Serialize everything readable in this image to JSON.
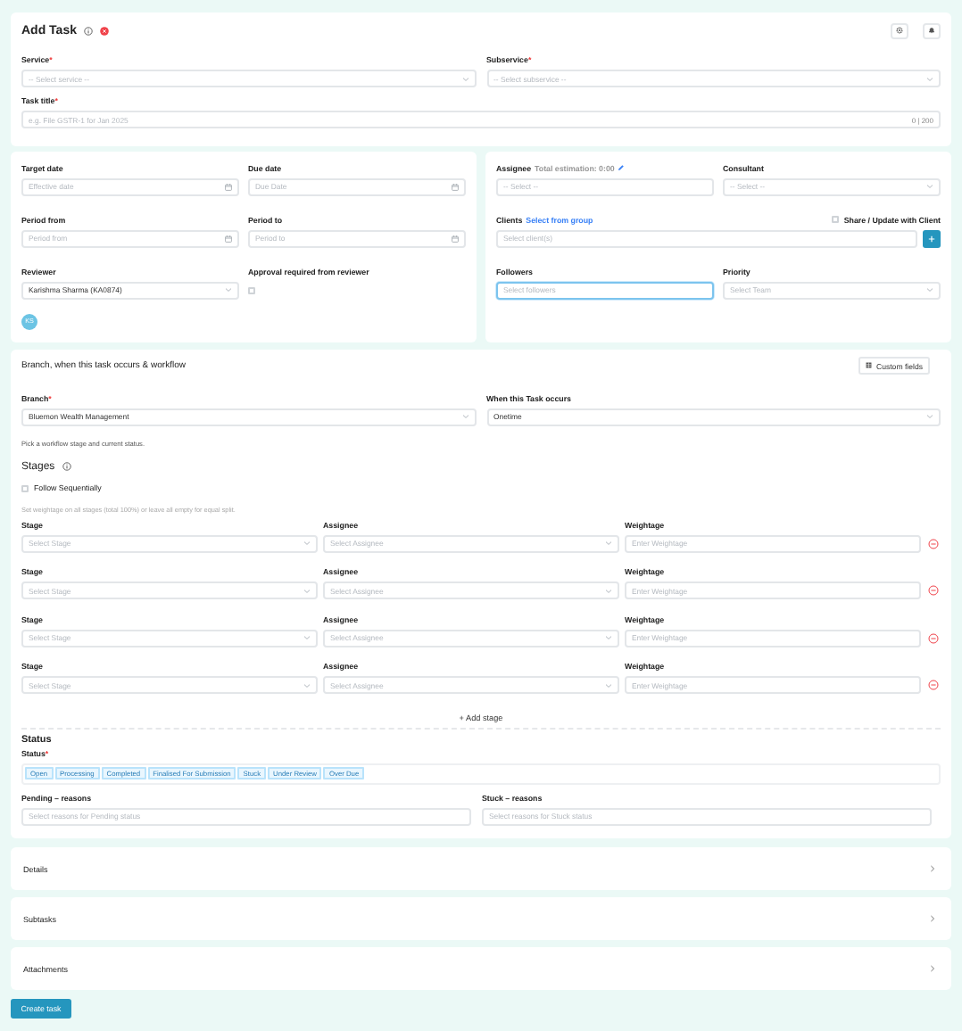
{
  "header": {
    "title": "Add Task"
  },
  "service": {
    "label": "Service",
    "mark": "*",
    "placeholder": "-- Select service --"
  },
  "subservice": {
    "label": "Subservice",
    "mark": "*",
    "placeholder": "-- Select subservice --"
  },
  "task_title": {
    "label": "Task title",
    "mark": "*",
    "placeholder": "e.g. File GSTR-1 for Jan 2025",
    "counter": "0 | 200"
  },
  "dates": [
    {
      "label": "Target date",
      "placeholder": "Effective date"
    },
    {
      "label": "Due date",
      "placeholder": "Due Date"
    },
    {
      "label": "Period from",
      "placeholder": "Period from"
    },
    {
      "label": "Period to",
      "placeholder": "Period to"
    }
  ],
  "reviewer": {
    "label": "Reviewer",
    "value": "Karishma Sharma (KA0874)",
    "avatar": "KS"
  },
  "approval": {
    "label": "Approval required from reviewer",
    "checked": false
  },
  "assignee": {
    "label": "Assignee",
    "estimation": "Total estimation: 0:00",
    "placeholder": "-- Select --"
  },
  "consultant": {
    "label": "Consultant",
    "placeholder": "-- Select --"
  },
  "clients": {
    "label": "Clients",
    "link": "Select from group",
    "placeholder": "Select client(s)"
  },
  "share_with_client": {
    "label": "Share / Update with Client",
    "checked": false
  },
  "followers": {
    "label": "Followers",
    "placeholder": "Select followers",
    "focused": true
  },
  "priority": {
    "label": "Priority",
    "placeholder": "Select Team"
  },
  "workflow": {
    "title": "Branch, when this task occurs & workflow",
    "custom_fields": "Custom fields",
    "branch": {
      "label": "Branch",
      "mark": "*",
      "value": "Bluemon Wealth Management"
    },
    "occurs": {
      "label": "When this Task occurs",
      "value": "Onetime"
    },
    "hint": "Pick a workflow stage and current status.",
    "stages_title": "Stages",
    "follow_sequentially": {
      "label": "Follow Sequentially",
      "checked": false
    },
    "weightage_hint": "Set weightage on all stages (total 100%) or leave all empty for equal split.",
    "stages": [
      {
        "stage_label": "Stage",
        "stage_placeholder": "Select Stage",
        "assignee_label": "Assignee",
        "assignee_placeholder": "Select Assignee",
        "weightage_label": "Weightage",
        "weightage_placeholder": "Enter Weightage"
      },
      {
        "stage_label": "Stage",
        "stage_placeholder": "Select Stage",
        "assignee_label": "Assignee",
        "assignee_placeholder": "Select Assignee",
        "weightage_label": "Weightage",
        "weightage_placeholder": "Enter Weightage"
      },
      {
        "stage_label": "Stage",
        "stage_placeholder": "Select Stage",
        "assignee_label": "Assignee",
        "assignee_placeholder": "Select Assignee",
        "weightage_label": "Weightage",
        "weightage_placeholder": "Enter Weightage"
      },
      {
        "stage_label": "Stage",
        "stage_placeholder": "Select Stage",
        "assignee_label": "Assignee",
        "assignee_placeholder": "Select Assignee",
        "weightage_label": "Weightage",
        "weightage_placeholder": "Enter Weightage"
      }
    ],
    "add_stage": "+ Add stage"
  },
  "status": {
    "title": "Status",
    "label": "Status",
    "mark": "*",
    "options": [
      {
        "label": "Open",
        "selected": false
      },
      {
        "label": "Processing",
        "selected": false
      },
      {
        "label": "Completed",
        "selected": false
      },
      {
        "label": "Finalised For Submission",
        "selected": false
      },
      {
        "label": "Stuck",
        "selected": false
      },
      {
        "label": "Under Review",
        "selected": false
      },
      {
        "label": "Over Due",
        "selected": false
      }
    ]
  },
  "pending_reasons": {
    "label": "Pending – reasons",
    "placeholder": "Select reasons for Pending status"
  },
  "stuck_reasons": {
    "label": "Stuck – reasons",
    "placeholder": "Select reasons for Stuck status"
  },
  "sections": [
    {
      "title": "Details"
    },
    {
      "title": "Subtasks"
    },
    {
      "title": "Attachments"
    }
  ],
  "create_button": "Create task"
}
